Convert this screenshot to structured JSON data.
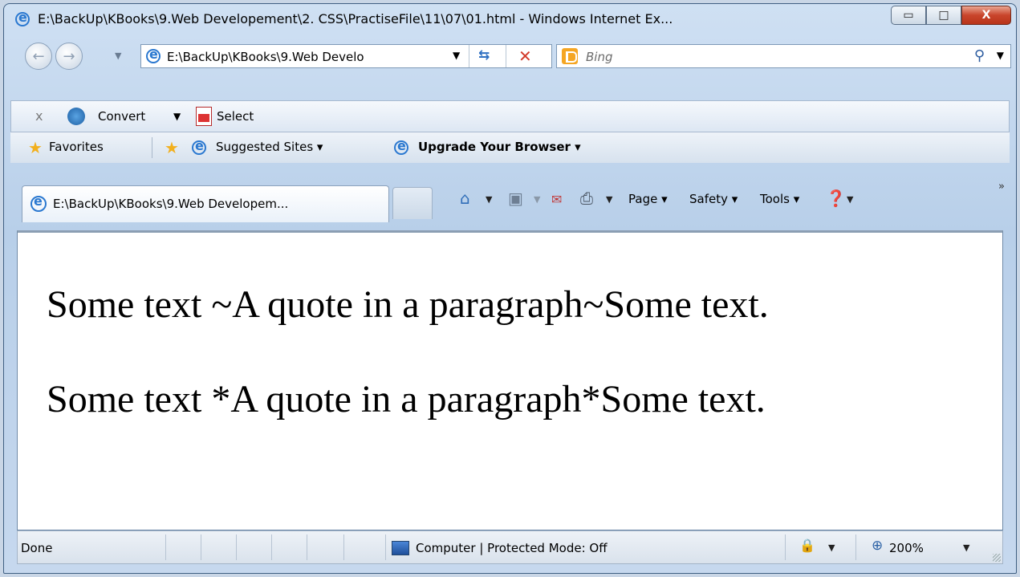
{
  "window": {
    "title": "E:\\BackUp\\KBooks\\9.Web Developement\\2. CSS\\PractiseFile\\11\\07\\01.html - Windows Internet Ex...",
    "minimize_glyph": "▭",
    "maximize_glyph": "□",
    "close_glyph": "X"
  },
  "navigation": {
    "back_glyph": "←",
    "forward_glyph": "→",
    "address": "E:\\BackUp\\KBooks\\9.Web Develo",
    "search_placeholder": "Bing"
  },
  "command_bar": {
    "close_glyph": "x",
    "convert_label": "Convert",
    "select_label": "Select"
  },
  "favorites_bar": {
    "favorites_label": "Favorites",
    "suggested_sites_label": "Suggested Sites ▾",
    "upgrade_label": "Upgrade Your Browser ▾"
  },
  "tab": {
    "title": "E:\\BackUp\\KBooks\\9.Web Developem..."
  },
  "toolbar": {
    "page_label": "Page",
    "safety_label": "Safety",
    "tools_label": "Tools"
  },
  "content": {
    "line1": "Some text ~A quote in a paragraph~Some text.",
    "line2": "Some text *A quote in a paragraph*Some text."
  },
  "status_bar": {
    "status_text": "Done",
    "zone_text": "Computer | Protected Mode: Off",
    "zoom_text": "200%"
  },
  "colors": {
    "frame": "#c9d6e6",
    "close_button": "#c9452b",
    "bing_logo": "#f5a623"
  }
}
